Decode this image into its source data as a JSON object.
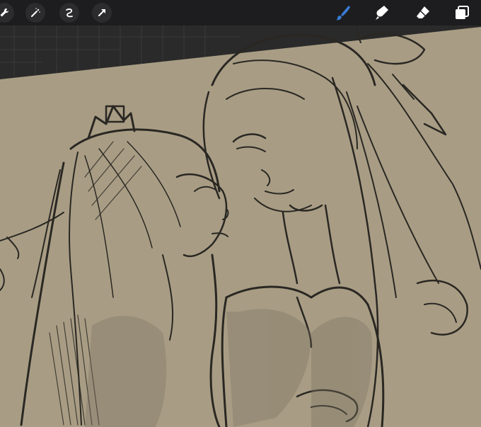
{
  "toolbar": {
    "left_tools": [
      "wrench-icon",
      "magic-wand-icon",
      "selection-icon",
      "transform-arrow-icon"
    ],
    "right_tools": [
      "brush-icon",
      "smudge-icon",
      "eraser-icon",
      "layers-icon"
    ],
    "active_tool": "brush-icon",
    "colors": {
      "bar": "#1d1d1f",
      "button": "#2c2c2e",
      "icon": "#ffffff",
      "active": "#3a7bd5"
    }
  },
  "canvas": {
    "paper_color": "#a89d84",
    "outside_color": "#2a2a2a",
    "ink_color": "#2a2723",
    "content": "sketch-drawing"
  }
}
